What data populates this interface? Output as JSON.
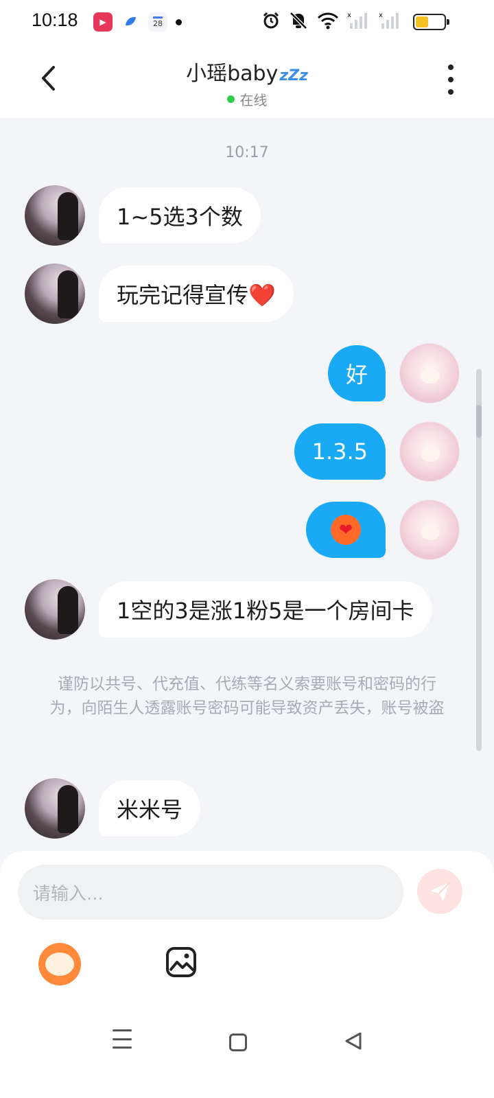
{
  "status_bar": {
    "time": "10:18",
    "calendar_day": "28",
    "battery_percent": 45
  },
  "header": {
    "title": "小瑶baby",
    "title_badge": "zZz",
    "online_status": "在线"
  },
  "chat": {
    "timestamp": "10:17",
    "messages": [
      {
        "from": "other",
        "text": "1~5选3个数"
      },
      {
        "from": "other",
        "text": "玩完记得宣传❤️"
      },
      {
        "from": "me",
        "text": "好"
      },
      {
        "from": "me",
        "text": "1.3.5"
      },
      {
        "from": "me",
        "text": "",
        "sticker": "heart-sticker"
      },
      {
        "from": "other",
        "text": "1空的3是涨1粉5是一个房间卡"
      },
      {
        "from": "other",
        "text": "米米号"
      }
    ],
    "warning": "谨防以共号、代充值、代练等名义索要账号和密码的行为，向陌生人透露账号密码可能导致资产丢失，账号被盗"
  },
  "input": {
    "placeholder": "请输入..."
  },
  "colors": {
    "bubble_out": "#1aa9f5",
    "bubble_in": "#ffffff",
    "online_dot": "#2ecc48",
    "background": "#f3f5f8"
  }
}
